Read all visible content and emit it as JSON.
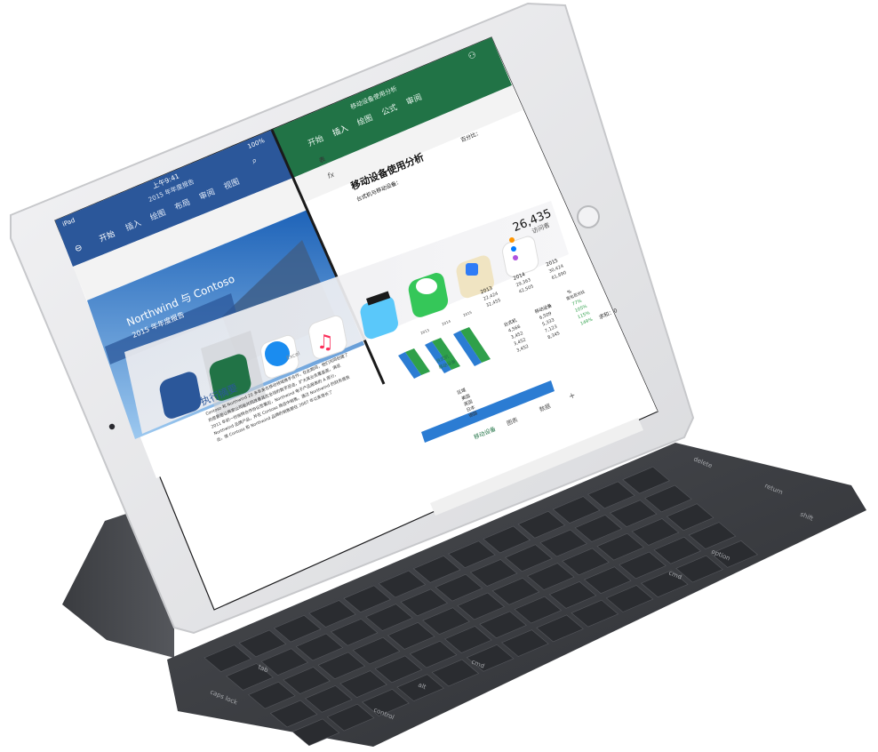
{
  "status_bar": {
    "carrier": "iPad",
    "time": "上午9:41",
    "battery": "100%"
  },
  "word_app": {
    "doc_title": "2015 年年度报告",
    "tabs": [
      "开始",
      "插入",
      "绘图",
      "布局",
      "审阅",
      "视图"
    ],
    "active_tab": "开始",
    "cover_title": "Northwind 与 Contoso",
    "cover_subtitle": "2015 年年度报告",
    "section_heading": "执行摘要",
    "body_lines": [
      "Contoso 和 Northwind 20 多年来在移动领域携手合作，在此期间，他们共同创建了",
      "的愿景是让两家公司能共同改善其在全球的数字足迹，扩大其业务覆盖面，满足",
      "2011 年初一份独特合作协议签署后，Northwind 电子产品报表的 A 部分，",
      "Northwind 品牌产品，并在 Contoso 商店中销售。通过 Northwind 的财务报告",
      "出，使 Contoso 和 Northwind 品牌的销售额在 2007 年以来增长了"
    ]
  },
  "excel_app": {
    "doc_title": "移动设备使用分析",
    "tabs": [
      "开始",
      "插入",
      "绘图",
      "公式",
      "审阅"
    ],
    "active_tab": "插入",
    "table_button": "表",
    "formula_label": "fx",
    "sheet_title": "移动设备使用分析",
    "sheet_subtitle": "台式机与移动设备：",
    "percent_label": "百分比：",
    "big_number": "26,435",
    "big_number_label": "访问者",
    "year_labels": [
      "2013",
      "2014",
      "2015"
    ],
    "year_values": [
      "22,424",
      "29,363",
      "30,424"
    ],
    "year_values_2": [
      "32,455",
      "42,505",
      "61,890"
    ],
    "chart_axis": [
      "2013",
      "2014",
      "2015"
    ],
    "section_device": "台式机",
    "section_mobile": "移动设备",
    "table_header": [
      "台式机",
      "移动设备",
      "%"
    ],
    "table_rows": [
      {
        "c1": "4,566",
        "c2": "6,509",
        "c3": "77%"
      },
      {
        "c1": "3,452",
        "c2": "5,333",
        "c3": "105%"
      },
      {
        "c1": "3,452",
        "c2": "7,123",
        "c3": "115%"
      },
      {
        "c1": "3,452",
        "c2": "8,345",
        "c3": "149%"
      }
    ],
    "pct_header": "变化百分比",
    "region_title": "区域分析",
    "region_header": "区域",
    "regions": [
      "美国",
      "英国",
      "日本",
      "德国"
    ],
    "sum_label": "求和：0",
    "sheet_tabs": [
      "移动设备",
      "图表",
      "数据"
    ],
    "add_sheet": "+"
  },
  "app_switcher": {
    "word_label": "",
    "excel_label": "Excel",
    "apps": [
      "Word",
      "Excel",
      "Safari",
      "音乐",
      "Clips",
      "信息",
      "地图",
      "提醒事项"
    ]
  },
  "keyboard": {
    "labels": [
      "delete",
      "return",
      "shift",
      "option",
      "cmd",
      "caps lock",
      "tab",
      "control",
      "alt",
      "cmd"
    ]
  },
  "colors": {
    "word_blue": "#2b579a",
    "excel_green": "#217346",
    "device_silver": "#e6e6e8",
    "keyboard_dark": "#3c3e42"
  }
}
